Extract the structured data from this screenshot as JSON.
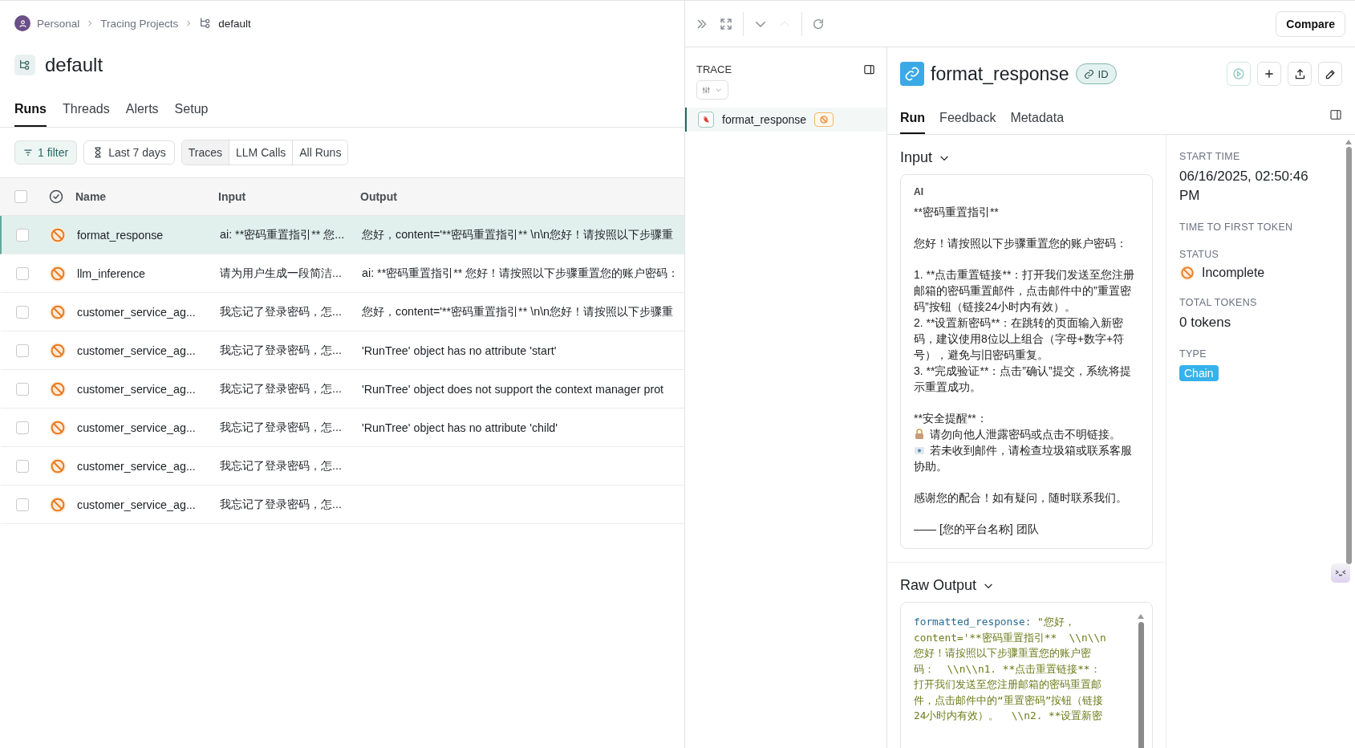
{
  "breadcrumb": [
    {
      "label": "Personal",
      "kind": "workspace"
    },
    {
      "label": "Tracing Projects",
      "kind": "link"
    },
    {
      "label": "default",
      "kind": "project"
    }
  ],
  "project": {
    "title": "default"
  },
  "tabs": [
    {
      "label": "Runs",
      "selected": true
    },
    {
      "label": "Threads",
      "selected": false
    },
    {
      "label": "Alerts",
      "selected": false
    },
    {
      "label": "Setup",
      "selected": false
    }
  ],
  "filters": {
    "filter": "1 filter",
    "time_range": "Last 7 days",
    "views": [
      {
        "label": "Traces",
        "selected": true
      },
      {
        "label": "LLM Calls",
        "selected": false
      },
      {
        "label": "All Runs",
        "selected": false
      }
    ]
  },
  "table": {
    "all_checked": false,
    "columns": [
      "Name",
      "Input",
      "Output"
    ],
    "rows": [
      {
        "name": "format_response",
        "input": "ai: **密码重置指引** 您...",
        "output": "您好，content='**密码重置指引** \\n\\n您好！请按照以下步骤重",
        "selected": true,
        "checked": false
      },
      {
        "name": "llm_inference",
        "input": "请为用户生成一段简洁...",
        "output": "ai: **密码重置指引** 您好！请按照以下步骤重置您的账户密码：",
        "selected": false,
        "checked": false
      },
      {
        "name": "customer_service_ag...",
        "input": "我忘记了登录密码，怎...",
        "output": "您好，content='**密码重置指引** \\n\\n您好！请按照以下步骤重",
        "selected": false,
        "checked": false
      },
      {
        "name": "customer_service_ag...",
        "input": "我忘记了登录密码，怎...",
        "output": "'RunTree' object has no attribute 'start'",
        "selected": false,
        "checked": false
      },
      {
        "name": "customer_service_ag...",
        "input": "我忘记了登录密码，怎...",
        "output": "'RunTree' object does not support the context manager prot",
        "selected": false,
        "checked": false
      },
      {
        "name": "customer_service_ag...",
        "input": "我忘记了登录密码，怎...",
        "output": "'RunTree' object has no attribute 'child'",
        "selected": false,
        "checked": false
      },
      {
        "name": "customer_service_ag...",
        "input": "我忘记了登录密码，怎...",
        "selected": false,
        "checked": false
      },
      {
        "name": "customer_service_ag...",
        "input": "我忘记了登录密码，怎...",
        "selected": false,
        "checked": false
      }
    ]
  },
  "toolbar": {
    "compare": "Compare"
  },
  "trace": {
    "label": "TRACE",
    "items": [
      {
        "name": "format_response",
        "selected": true
      }
    ]
  },
  "run": {
    "title": "format_response",
    "id_badge": "ID",
    "tabs": [
      {
        "label": "Run",
        "selected": true
      },
      {
        "label": "Feedback",
        "selected": false
      },
      {
        "label": "Metadata",
        "selected": false
      }
    ],
    "input": {
      "heading": "Input",
      "role": "AI",
      "blocks": [
        [
          {
            "text": "**密码重置指引**"
          }
        ],
        [
          {
            "text": "您好！请按照以下步骤重置您的账户密码："
          }
        ],
        [
          {
            "text": "1. **点击重置链接**：打开我们发送至您注册邮箱的密码重置邮件，点击邮件中的”重置密码”按钮（链接24小时内有效）。"
          },
          {
            "text": "2. **设置新密码**：在跳转的页面输入新密码，建议使用8位以上组合（字母+数字+符号），避免与旧密码重复。"
          },
          {
            "text": "3. **完成验证**：点击”确认”提交，系统将提示重置成功。"
          }
        ],
        [
          {
            "text": "**安全提醒**："
          },
          {
            "text": "请勿向他人泄露密码或点击不明链接。",
            "kind": "lock"
          },
          {
            "text": "若未收到邮件，请检查垃圾箱或联系客服协助。",
            "kind": "mail"
          }
        ],
        [
          {
            "text": "感谢您的配合！如有疑问，随时联系我们。"
          }
        ],
        [
          {
            "text": "—— [您的平台名称] 团队"
          }
        ]
      ]
    },
    "raw_output": {
      "heading": "Raw Output",
      "key": "formatted_response:",
      "lines": [
        " \"您好，",
        "content='**密码重置指引**  \\\\n\\\\n",
        "您好！请按照以下步骤重置您的账户密",
        "码：  \\\\n\\\\n1. **点击重置链接**：",
        "打开我们发送至您注册邮箱的密码重置邮",
        "件，点击邮件中的“重置密码”按钮（链接",
        "24小时内有效）。  \\\\n2. **设置新密"
      ]
    }
  },
  "metadata": [
    {
      "label": "START TIME",
      "value": "06/16/2025, 02:50:46 PM",
      "kind": "text"
    },
    {
      "label": "TIME TO FIRST TOKEN"
    },
    {
      "label": "STATUS",
      "value": "Incomplete",
      "kind": "status"
    },
    {
      "label": "TOTAL TOKENS",
      "value": "0 tokens",
      "kind": "text"
    },
    {
      "label": "TYPE",
      "value": "Chain",
      "kind": "badge"
    }
  ]
}
